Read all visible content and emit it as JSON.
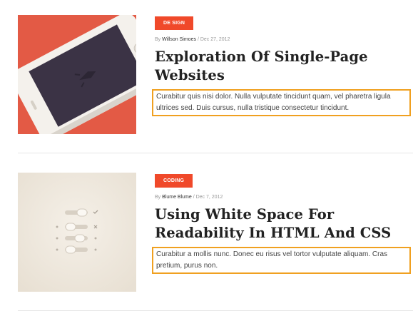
{
  "colors": {
    "accent": "#f0492a",
    "highlight_border": "#f0a020",
    "thumb1_bg": "#e35a45",
    "thumb2_bg": "#efe8dd"
  },
  "posts": [
    {
      "category": "DE SIGN",
      "by": "By",
      "author": "Willson Simoes",
      "date": "/ Dec 27, 2012",
      "title": "Exploration Of Single-Page Websites",
      "excerpt": "Curabitur quis nisi dolor. Nulla vulputate tincidunt quam, vel pharetra ligula ultrices sed. Duis cursus, nulla tristique consectetur tincidunt.",
      "thumbnail_icon": "phone-illustration"
    },
    {
      "category": "CODING",
      "by": "By",
      "author": "Blume Blume",
      "date": "/ Dec 7, 2012",
      "title": "Using White Space For Readability In HTML And CSS",
      "excerpt": "Curabitur a mollis nunc. Donec eu risus vel tortor vulputate aliquam. Cras pretium, purus non.",
      "thumbnail_icon": "toggle-switches-illustration"
    }
  ]
}
